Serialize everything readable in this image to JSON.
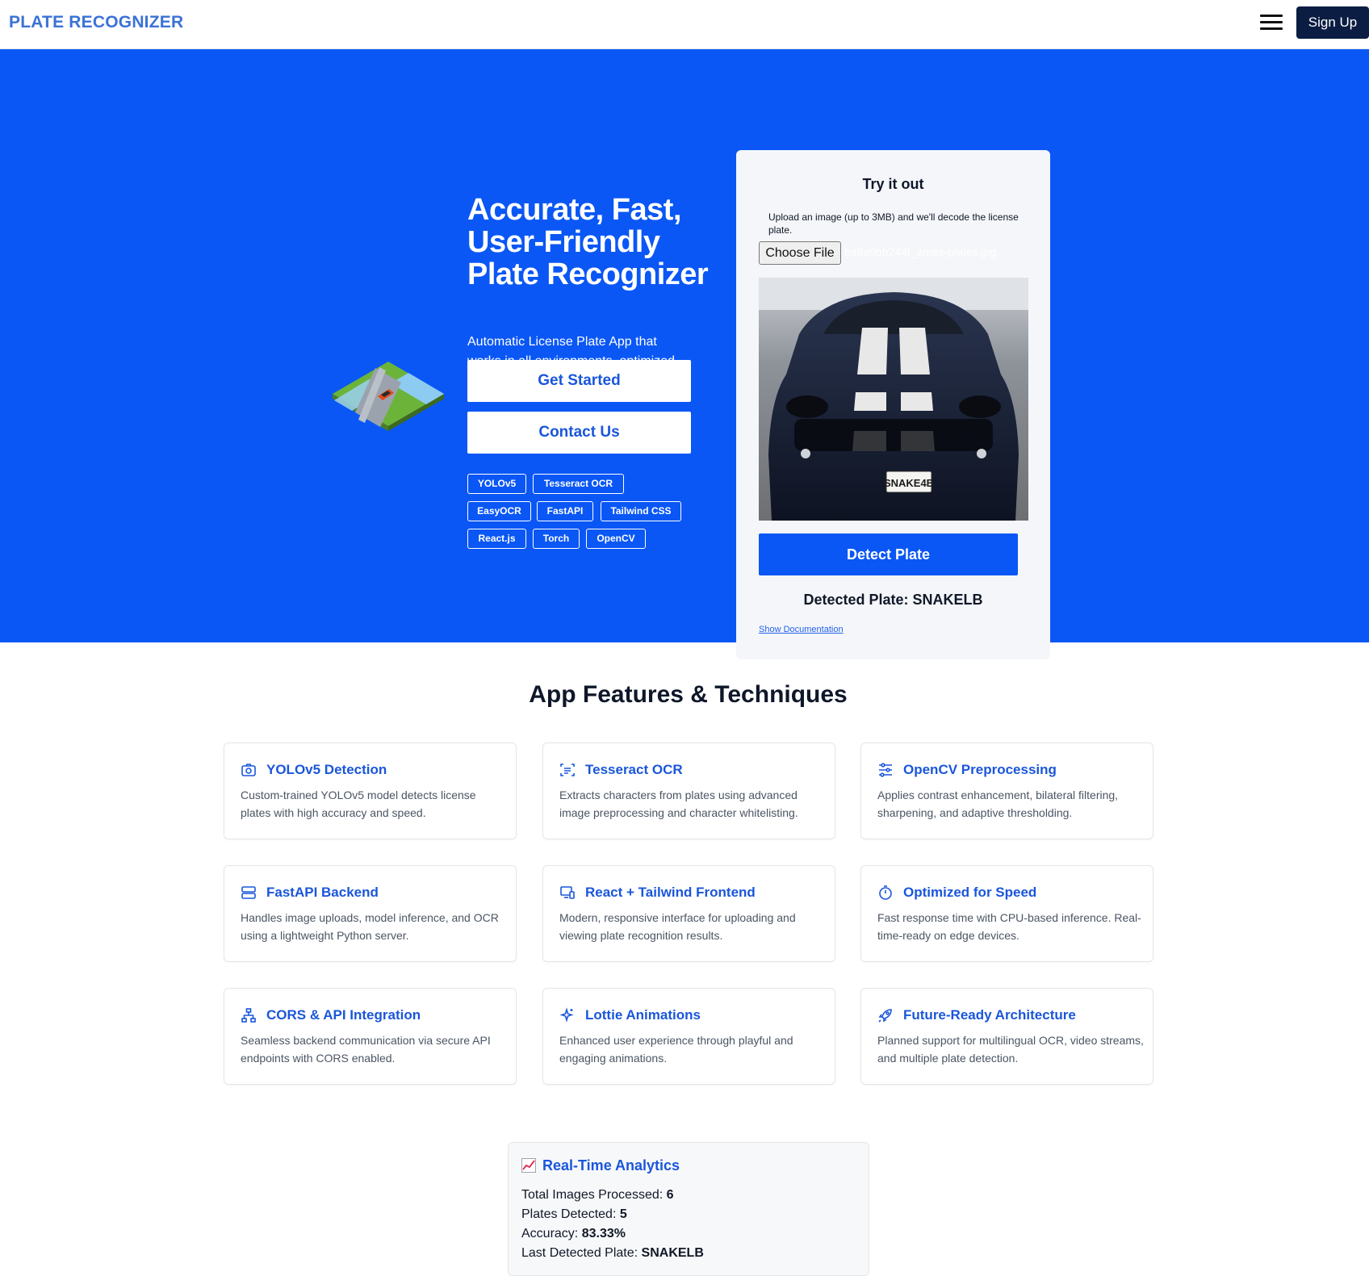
{
  "nav": {
    "brand": "PLATE RECOGNIZER",
    "signup_label": "Sign Up"
  },
  "hero": {
    "title": "Accurate, Fast, User-Friendly Plate Recognizer",
    "subtitle": "Automatic License Plate App that works in all environments, optimized for speed and accuracy.",
    "get_started_label": "Get Started",
    "contact_label": "Contact Us",
    "tags": [
      "YOLOv5",
      "Tesseract OCR",
      "EasyOCR",
      "FastAPI",
      "Tailwind CSS",
      "React.js",
      "Torch",
      "OpenCV"
    ]
  },
  "try": {
    "title": "Try it out",
    "description": "Upload an image (up to 3MB) and we'll decode the license plate.",
    "choose_file_label": "Choose File",
    "file_name": "ba8a0bb244f_ames-plates.jpg",
    "plate_text": "SNAKE4B",
    "detect_label": "Detect Plate",
    "detected_label": "Detected Plate: SNAKELB",
    "show_docs_label": "Show Documentation"
  },
  "features": {
    "title": "App Features & Techniques",
    "items": [
      {
        "icon": "camera-icon",
        "title": "YOLOv5 Detection",
        "desc": "Custom-trained YOLOv5 model detects license plates with high accuracy and speed."
      },
      {
        "icon": "document-scan-icon",
        "title": "Tesseract OCR",
        "desc": "Extracts characters from plates using advanced image preprocessing and character whitelisting."
      },
      {
        "icon": "sliders-icon",
        "title": "OpenCV Preprocessing",
        "desc": "Applies contrast enhancement, bilateral filtering, sharpening, and adaptive thresholding."
      },
      {
        "icon": "server-icon",
        "title": "FastAPI Backend",
        "desc": "Handles image uploads, model inference, and OCR using a lightweight Python server."
      },
      {
        "icon": "devices-icon",
        "title": "React + Tailwind Frontend",
        "desc": "Modern, responsive interface for uploading and viewing plate recognition results."
      },
      {
        "icon": "stopwatch-icon",
        "title": "Optimized for Speed",
        "desc": "Fast response time with CPU-based inference. Real-time-ready on edge devices."
      },
      {
        "icon": "network-icon",
        "title": "CORS & API Integration",
        "desc": "Seamless backend communication via secure API endpoints with CORS enabled."
      },
      {
        "icon": "sparkles-icon",
        "title": "Lottie Animations",
        "desc": "Enhanced user experience through playful and engaging animations."
      },
      {
        "icon": "rocket-icon",
        "title": "Future-Ready Architecture",
        "desc": "Planned support for multilingual OCR, video streams, and multiple plate detection."
      }
    ]
  },
  "analytics": {
    "title": "Real-Time Analytics",
    "total_label": "Total Images Processed:",
    "total_value": "6",
    "detected_label": "Plates Detected:",
    "detected_value": "5",
    "accuracy_label": "Accuracy:",
    "accuracy_value": "83.33%",
    "last_label": "Last Detected Plate:",
    "last_value": "SNAKELB"
  },
  "colors": {
    "brand_blue": "#0a57f5",
    "accent_blue": "#1a56db",
    "navy": "#0b1d42"
  }
}
